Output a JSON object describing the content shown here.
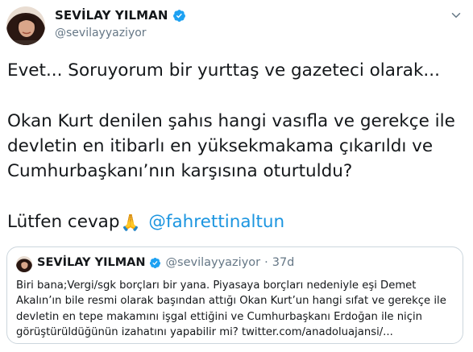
{
  "author": {
    "display_name": "SEVİLAY YILMAN",
    "handle": "@sevilayyaziyor",
    "avatar_icon": "profile-photo",
    "verified_icon": "verified-badge-icon",
    "verified_color": "#1da1f2"
  },
  "tweet": {
    "lines": [
      "Evet... Soruyorum bir yurttaş ve gazeteci olarak...",
      "",
      "Okan Kurt denilen şahıs hangi vasıfla ve gerekçe ile",
      "devletin en itibarlı en yüksekmakama çıkarıldı ve",
      "Cumhurbaşkanı’nın karşısına oturtuldu?",
      ""
    ],
    "last_line_text": "Lütfen cevap",
    "emoji": "🙏",
    "mention": "@fahrettinaltun",
    "mention_color": "#1b95e0"
  },
  "quoted_tweet": {
    "display_name": "SEVİLAY YILMAN",
    "handle": "@sevilayyaziyor",
    "separator": "·",
    "time": "37d",
    "lines": [
      "Biri bana;Vergi/sgk borçları bir yana. Piyasaya borçları nedeniyle eşi Demet",
      "Akalın’ın bile resmi olarak başından attığı Okan Kurt’un hangi sıfat ve gerekçe ile",
      "devletin en tepe makamını işgal ettiğini ve Cumhurbaşkanı Erdoğan ile niçin",
      "görüştürüldüğünün izahatını yapabilir mi? twitter.com/anadoluajansi/..."
    ]
  },
  "menu_icon": "chevron-down-icon"
}
